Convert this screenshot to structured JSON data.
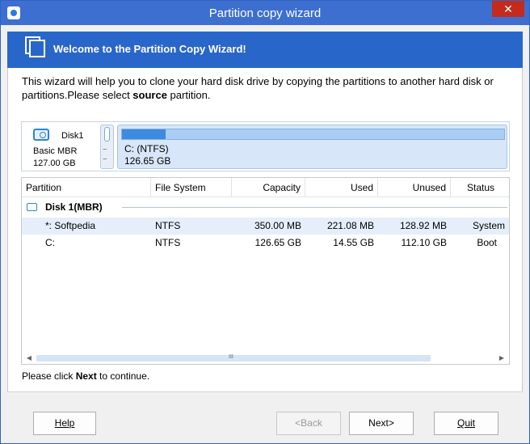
{
  "window": {
    "title": "Partition copy wizard",
    "close_glyph": "✕"
  },
  "banner": {
    "title": "Welcome to the Partition Copy Wizard!"
  },
  "intro": {
    "text_before": "This wizard will help you to clone your hard disk drive by copying the partitions to another hard disk or partitions.Please select ",
    "bold": "source",
    "text_after": " partition."
  },
  "diskmap": {
    "disk_name": "Disk1",
    "disk_type": "Basic MBR",
    "disk_size": "127.00 GB",
    "small_partition_dots": "...",
    "partition_label": "C: (NTFS)",
    "partition_capacity": "126.65 GB",
    "partition_used_fraction": 0.115
  },
  "table": {
    "columns": [
      "Partition",
      "File System",
      "Capacity",
      "Used",
      "Unused",
      "Status"
    ],
    "group": "Disk 1(MBR)",
    "rows": [
      {
        "partition": "*: Softpedia",
        "fs": "NTFS",
        "capacity": "350.00 MB",
        "used": "221.08 MB",
        "unused": "128.92 MB",
        "status": "System",
        "selected": true
      },
      {
        "partition": "C:",
        "fs": "NTFS",
        "capacity": "126.65 GB",
        "used": "14.55 GB",
        "unused": "112.10 GB",
        "status": "Boot",
        "selected": false
      }
    ],
    "scroll_grip": "III"
  },
  "continue": {
    "before": "Please click ",
    "bold": "Next",
    "after": " to continue."
  },
  "buttons": {
    "help": "Help",
    "back": "<Back",
    "next": "Next>",
    "quit": "Quit"
  },
  "colors": {
    "titlebar": "#3d6fd0",
    "banner": "#2966c9",
    "selection": "#e5effb",
    "accent": "#2c86d6"
  },
  "icons": {
    "app": "app-icon",
    "banner": "copy-pages-icon",
    "disk": "hard-disk-icon",
    "close": "close-icon"
  }
}
